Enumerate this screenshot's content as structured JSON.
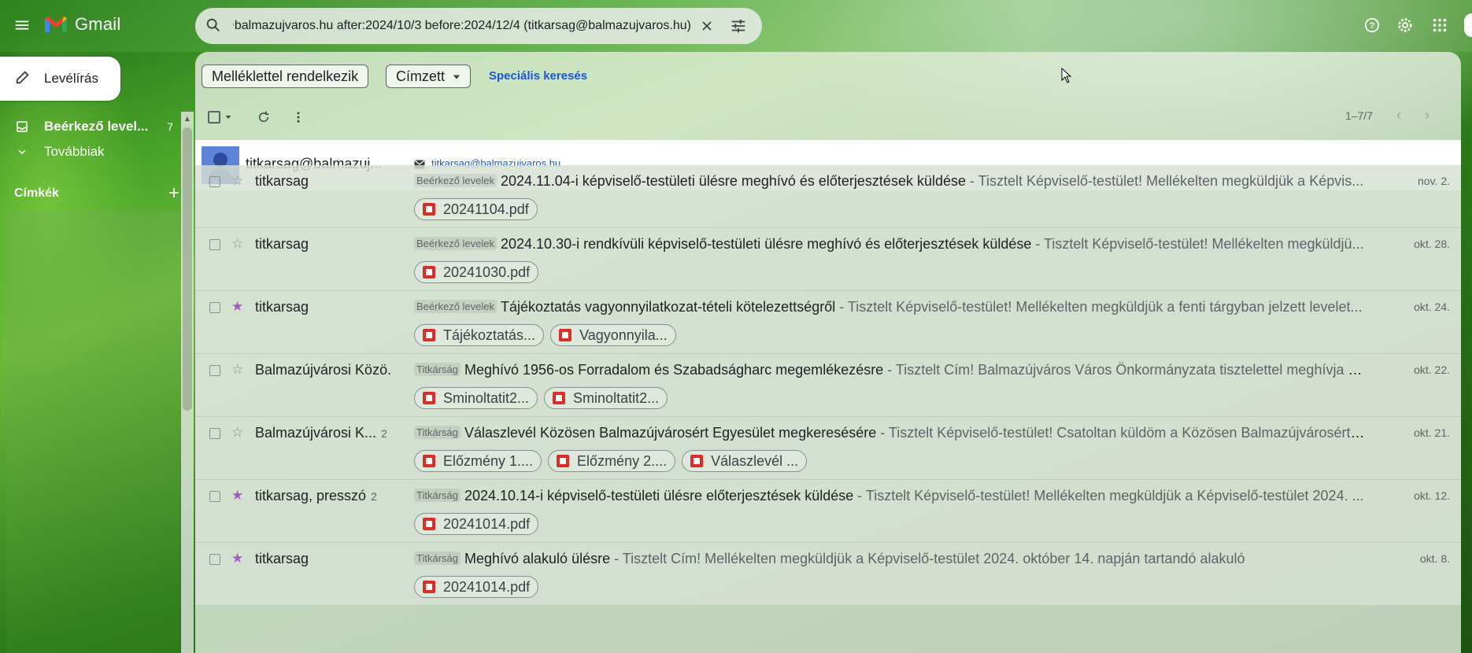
{
  "app": {
    "name": "Gmail"
  },
  "search": {
    "query": "(titkarsag@balmazujvaros.hu) titkarsag@balmazujvaros.hu after:2024/10/3 before:2024/12/4"
  },
  "sidebar": {
    "compose_label": "Levélírás",
    "inbox_label": "Beérkező level...",
    "inbox_count": "7",
    "more_label": "Továbbiak",
    "labels_heading": "Címkék",
    "labels_add": "+"
  },
  "filters": {
    "has_attachment": "Melléklettel rendelkezik",
    "to": "Címzett",
    "advanced": "Speciális keresés"
  },
  "pager": {
    "range": "1–7/7"
  },
  "contact": {
    "name": "titkarsag@balmazuj...",
    "email": "titkarsag@balmazujvaros.hu"
  },
  "emails": [
    {
      "sender": "titkarsag",
      "thread_count": "",
      "starred": false,
      "label": "Beérkező levelek",
      "subject": "2024.11.04-i képviselő-testületi ülésre meghívó és előterjesztések küldése",
      "snippet": " - Tisztelt Képviselő-testület! Mellékelten megküldjük a Képvis...",
      "date": "nov. 2.",
      "attachments": [
        "20241104.pdf"
      ]
    },
    {
      "sender": "titkarsag",
      "thread_count": "",
      "starred": false,
      "label": "Beérkező levelek",
      "subject": "2024.10.30-i rendkívüli képviselő-testületi ülésre meghívó és előterjesztések küldése",
      "snippet": " - Tisztelt Képviselő-testület! Mellékelten megküldjü...",
      "date": "okt. 28.",
      "attachments": [
        "20241030.pdf"
      ]
    },
    {
      "sender": "titkarsag",
      "thread_count": "",
      "starred": true,
      "label": "Beérkező levelek",
      "subject": "Tájékoztatás vagyonnyilatkozat-tételi kötelezettségről",
      "snippet": " - Tisztelt Képviselő-testület! Mellékelten megküldjük a fenti tárgyban jelzett levelet...",
      "date": "okt. 24.",
      "attachments": [
        "Tájékoztatás...",
        "Vagyonnyila..."
      ]
    },
    {
      "sender": "Balmazújvárosi Közö.",
      "thread_count": "",
      "starred": false,
      "label": "Titkárság",
      "subject": "Meghívó 1956-os Forradalom és Szabadságharc megemlékezésre",
      "snippet": " - Tisztelt Cím! Balmazújváros Város Önkormányzata tisztelettel meghívja Önt ...",
      "date": "okt. 22.",
      "attachments": [
        "Sminoltatit2...",
        "Sminoltatit2..."
      ]
    },
    {
      "sender": "Balmazújvárosi K...",
      "thread_count": "2",
      "starred": false,
      "label": "Titkárság",
      "subject": "Válaszlevél Közösen Balmazújvárosért Egyesület megkeresésére",
      "snippet": " - Tisztelt Képviselő-testület! Csatoltan küldöm a Közösen Balmazújvárosért Eg...",
      "date": "okt. 21.",
      "attachments": [
        "Előzmény 1....",
        "Előzmény 2....",
        "Válaszlevél ..."
      ]
    },
    {
      "sender": "titkarsag, presszó",
      "thread_count": "2",
      "starred": true,
      "label": "Titkárság",
      "subject": "2024.10.14-i képviselő-testületi ülésre előterjesztések küldése",
      "snippet": " - Tisztelt Képviselő-testület! Mellékelten megküldjük a Képviselő-testület 2024. ...",
      "date": "okt. 12.",
      "attachments": [
        "20241014.pdf"
      ]
    },
    {
      "sender": "titkarsag",
      "thread_count": "",
      "starred": true,
      "label": "Titkárság",
      "subject": "Meghívó alakuló ülésre",
      "snippet": " - Tisztelt Cím! Mellékelten megküldjük a Képviselő-testület 2024. október 14. napján tartandó alakuló",
      "date": "okt. 8.",
      "attachments": [
        "20241014.pdf"
      ]
    }
  ],
  "colors": {
    "star_on": "#a25cc0",
    "link": "#1a56d6",
    "pdf": "#d93025"
  },
  "icons": [
    "menu-icon",
    "gmail-logo",
    "search-icon",
    "close-icon",
    "tune-icon",
    "help-icon",
    "settings-icon",
    "apps-icon",
    "pencil-icon",
    "inbox-icon",
    "chevron-down-icon",
    "refresh-icon",
    "more-vert-icon",
    "chevron-left-icon",
    "chevron-right-icon",
    "star-icon",
    "pdf-icon",
    "mail-icon"
  ]
}
